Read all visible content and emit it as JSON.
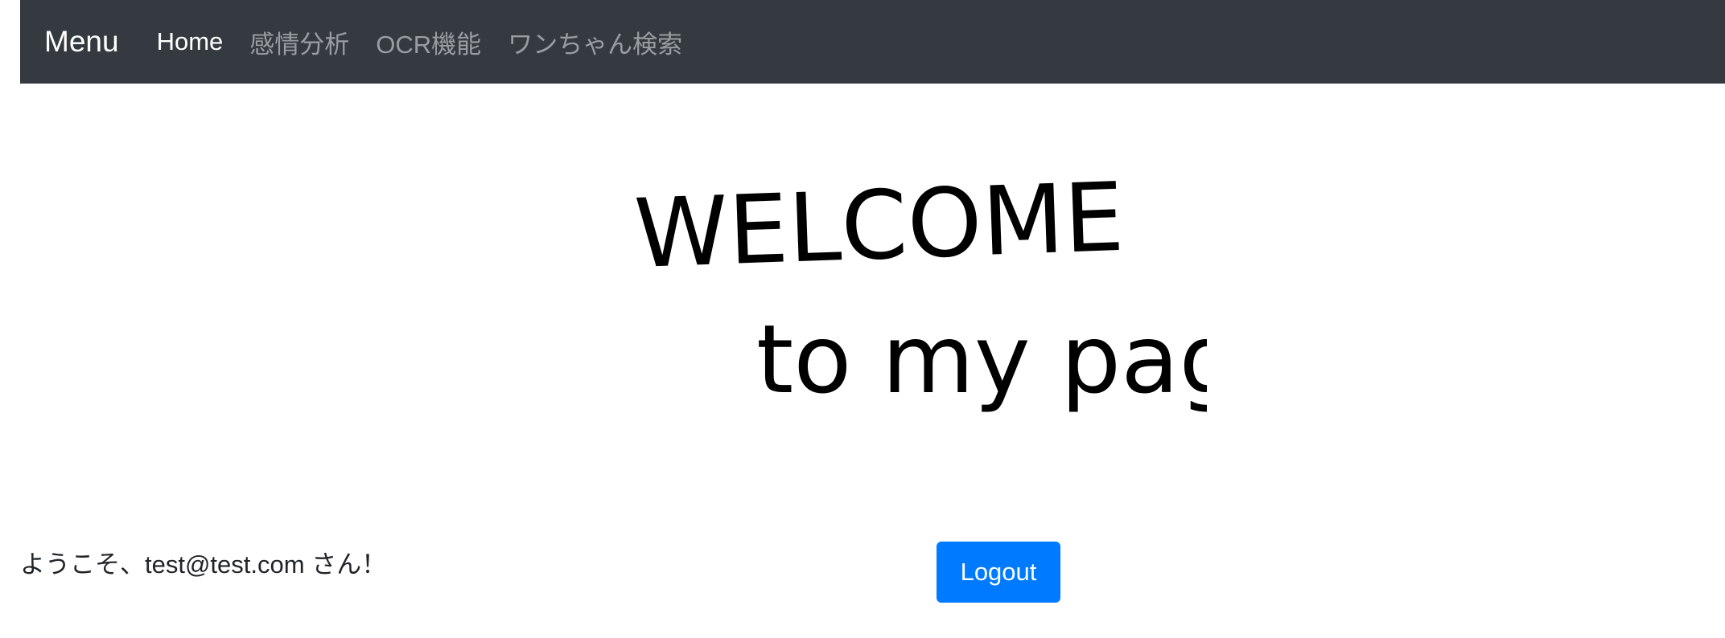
{
  "navbar": {
    "brand": "Menu",
    "items": [
      {
        "label": "Home",
        "active": true
      },
      {
        "label": "感情分析",
        "active": false
      },
      {
        "label": "OCR機能",
        "active": false
      },
      {
        "label": "ワンちゃん検索",
        "active": false
      }
    ],
    "background": "#343a40"
  },
  "hero": {
    "line1": "WELCOME",
    "line2": "to my page"
  },
  "greeting": "ようこそ、test@test.com さん！",
  "logout_button": {
    "label": "Logout",
    "color": "#007bff"
  }
}
